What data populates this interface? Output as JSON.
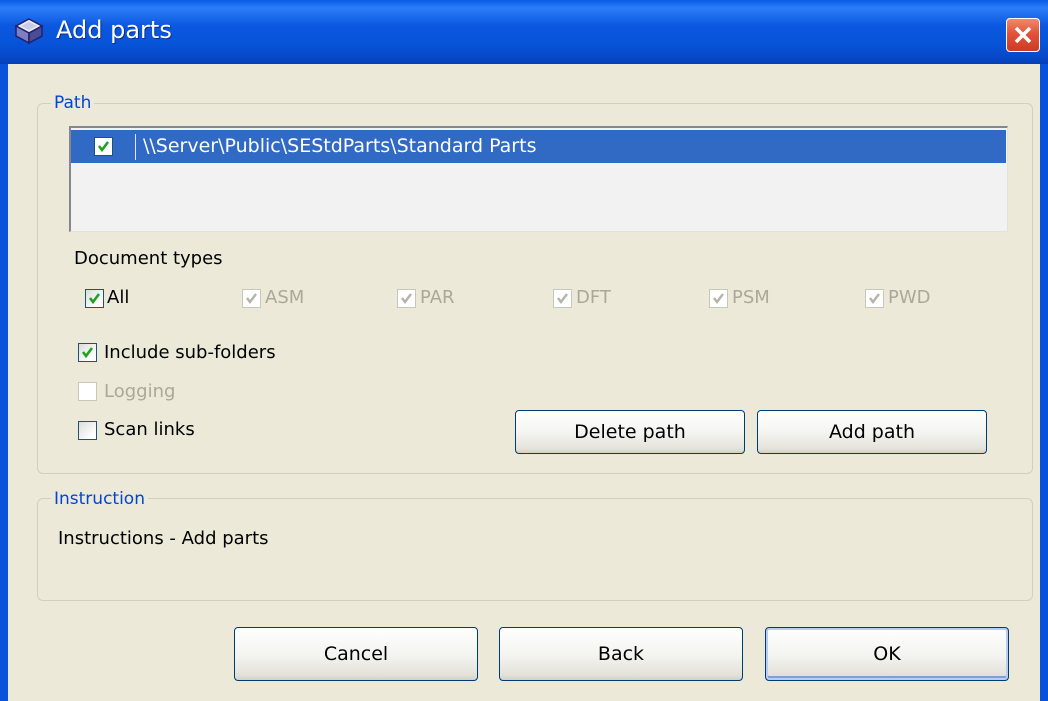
{
  "window": {
    "title": "Add parts",
    "icon": "app-icon",
    "close": "close-icon"
  },
  "path_group": {
    "label": "Path",
    "list": [
      {
        "checked": true,
        "text": "\\\\Server\\Public\\SEStdParts\\Standard Parts"
      }
    ],
    "doc_types_label": "Document types",
    "doc_types": [
      {
        "label": "All",
        "checked": true,
        "enabled": true
      },
      {
        "label": "ASM",
        "checked": true,
        "enabled": false
      },
      {
        "label": "PAR",
        "checked": true,
        "enabled": false
      },
      {
        "label": "DFT",
        "checked": true,
        "enabled": false
      },
      {
        "label": "PSM",
        "checked": true,
        "enabled": false
      },
      {
        "label": "PWD",
        "checked": true,
        "enabled": false
      }
    ],
    "options": [
      {
        "label": "Include sub-folders",
        "checked": true,
        "enabled": true
      },
      {
        "label": "Logging",
        "checked": false,
        "enabled": false
      },
      {
        "label": "Scan links",
        "checked": false,
        "enabled": true
      }
    ],
    "delete_path": "Delete path",
    "add_path": "Add path"
  },
  "instruction_group": {
    "label": "Instruction",
    "text": "Instructions - Add parts"
  },
  "footer": {
    "cancel": "Cancel",
    "back": "Back",
    "ok": "OK"
  },
  "colors": {
    "accent": "#0046d5",
    "selection": "#316ac5",
    "check": "#21a121",
    "face": "#ece9d8"
  }
}
